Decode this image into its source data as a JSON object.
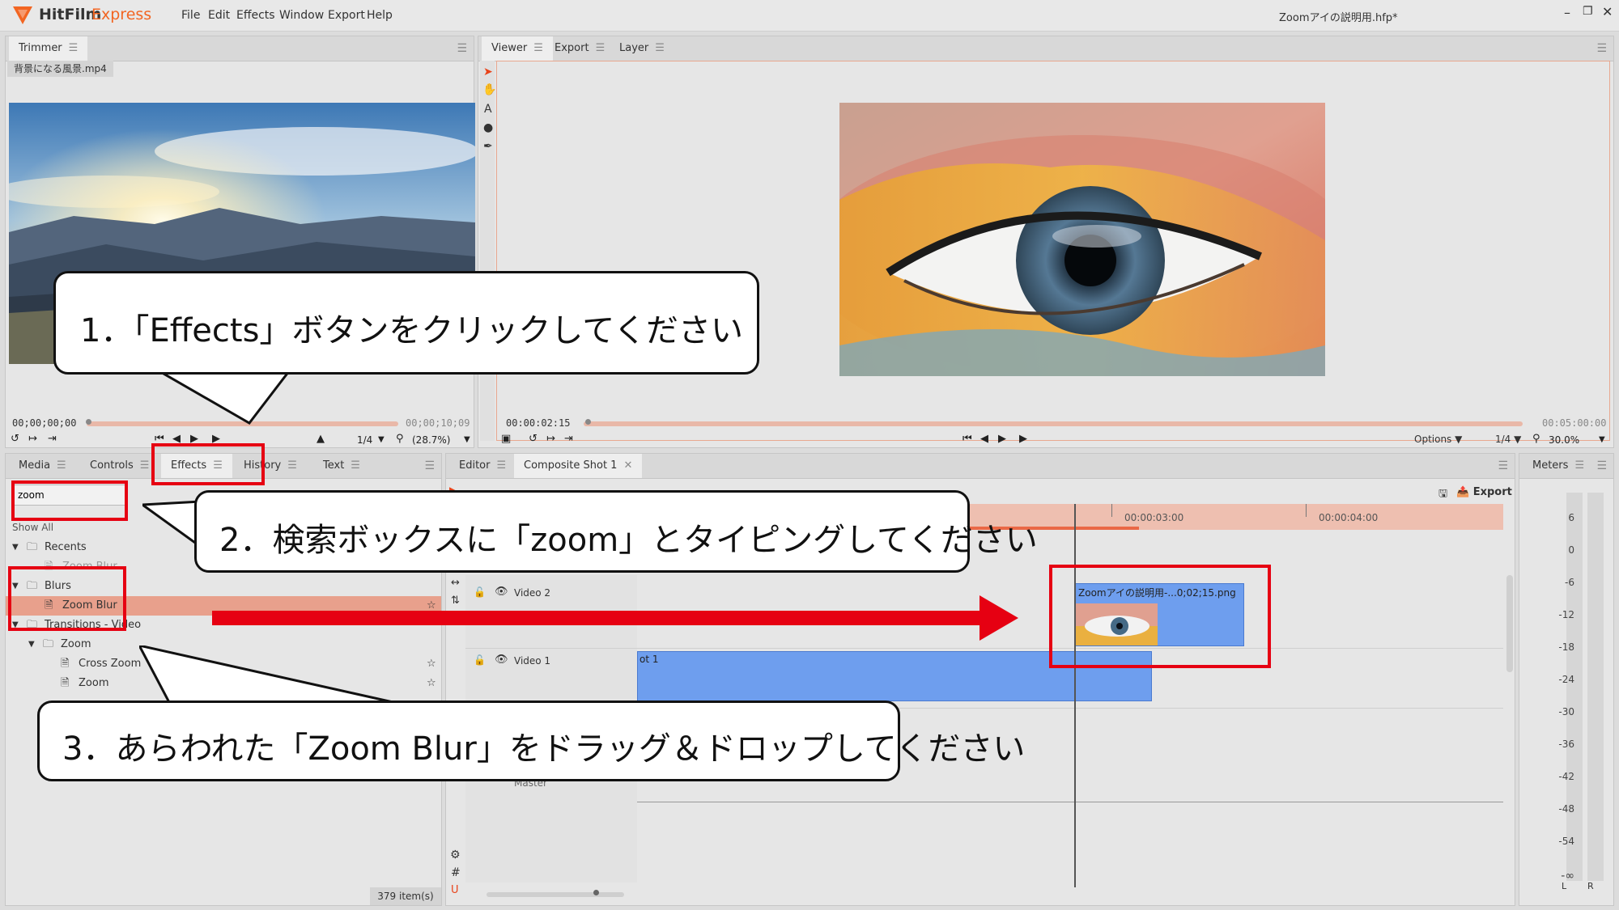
{
  "app": {
    "brand": "HitFilm",
    "brand2": "Express",
    "title": "Zoomアイの説明用.hfp*"
  },
  "menu": [
    "File",
    "Edit",
    "Effects",
    "Window",
    "Export",
    "Help"
  ],
  "trimmer": {
    "tab": "Trimmer",
    "file": "背景になる風景.mp4",
    "tc_start": "00;00;00;00",
    "tc_end": "00;00;10;09",
    "zoom_ratio": "1/4",
    "zoom_pct": "(28.7%)"
  },
  "viewer": {
    "tabs": [
      "Viewer",
      "Export",
      "Layer"
    ],
    "tc_start": "00:00:02:15",
    "tc_end": "00:05:00:00",
    "options": "Options",
    "ratio": "1/4",
    "zoom": "30.0%"
  },
  "left_panel": {
    "tabs": [
      "Media",
      "Controls",
      "Effects",
      "History",
      "Text"
    ],
    "search_value": "zoom",
    "show_all": "Show All",
    "tree": [
      {
        "label": "Recents",
        "kind": "folder",
        "level": 0
      },
      {
        "label": "Zoom Blur",
        "kind": "effect",
        "level": 1
      },
      {
        "label": "Blurs",
        "kind": "folder",
        "level": 0
      },
      {
        "label": "Zoom Blur",
        "kind": "effect",
        "level": 1,
        "selected": true
      },
      {
        "label": "Transitions - Video",
        "kind": "folder",
        "level": 0
      },
      {
        "label": "Zoom",
        "kind": "folder",
        "level": 1
      },
      {
        "label": "Cross Zoom",
        "kind": "effect",
        "level": 2
      },
      {
        "label": "Zoom",
        "kind": "effect",
        "level": 2
      }
    ],
    "item_count": "379 item(s)"
  },
  "editor": {
    "tabs": [
      "Editor",
      "Composite Shot 1"
    ],
    "export": "Export",
    "ruler_ticks": [
      "00:00:03:00",
      "00:00:04:00"
    ],
    "tracks": [
      {
        "name": "Video 2",
        "clip": "Zoomアイの説明用-...0;02;15.png"
      },
      {
        "name": "Video 1",
        "clip": "ot 1"
      },
      {
        "name": "Master"
      }
    ]
  },
  "meters": {
    "tab": "Meters",
    "scale": [
      "6",
      "0",
      "-6",
      "-12",
      "-18",
      "-24",
      "-30",
      "-36",
      "-42",
      "-48",
      "-54",
      "-∞"
    ],
    "channels": [
      "L",
      "R"
    ]
  },
  "callouts": [
    "1．「Effects」ボタンをクリックしてください",
    "2．検索ボックスに「zoom」とタイピングしてください",
    "3．あらわれた「Zoom Blur」をドラッグ＆ドロップしてください"
  ],
  "colors": {
    "accent": "#e8431a",
    "callout_red": "#e60012",
    "clip_blue": "#6e9eee",
    "selected": "#e8a08c"
  }
}
